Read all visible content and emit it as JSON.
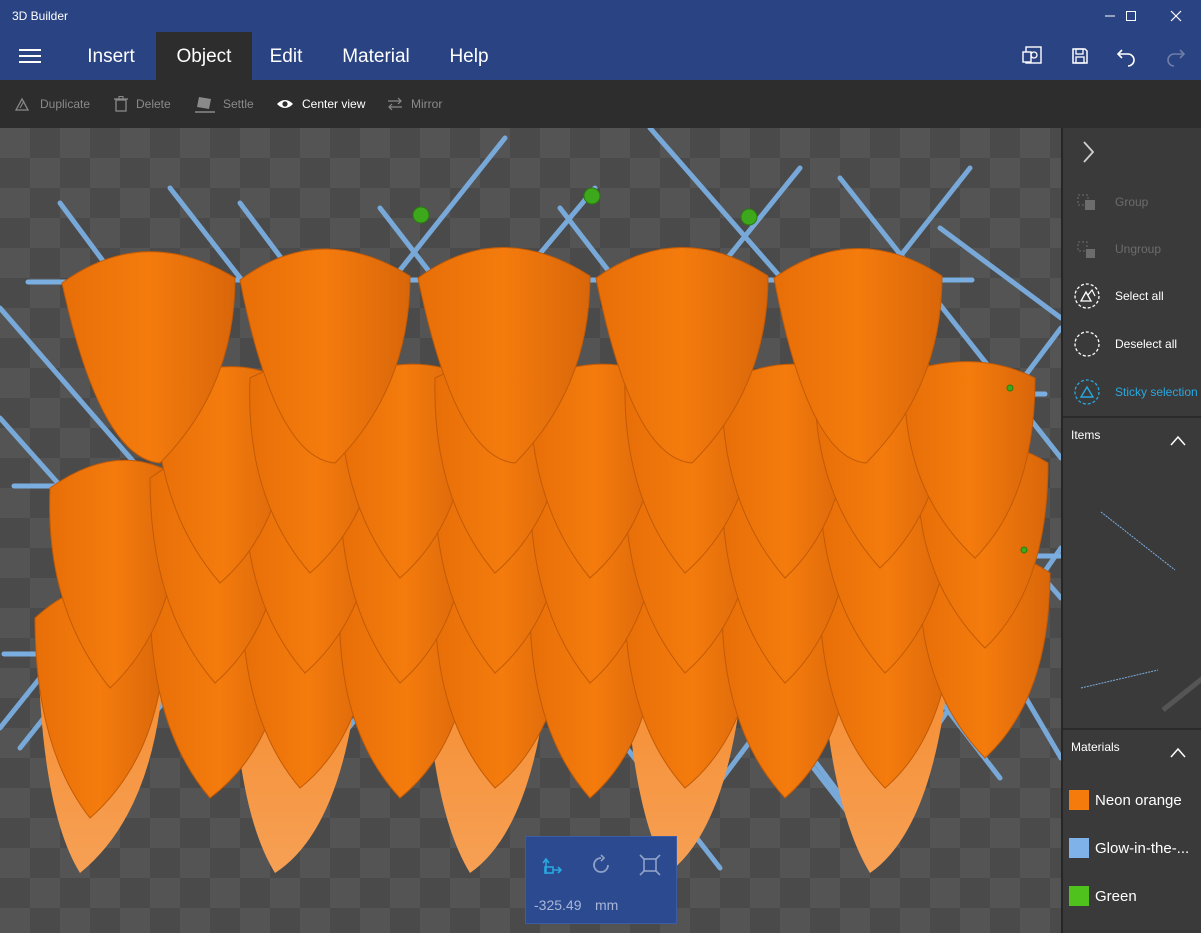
{
  "window": {
    "title": "3D Builder"
  },
  "menu": {
    "tabs": [
      {
        "label": "Insert"
      },
      {
        "label": "Object"
      },
      {
        "label": "Edit"
      },
      {
        "label": "Material"
      },
      {
        "label": "Help"
      }
    ],
    "active_tab": "Object"
  },
  "toolbar": {
    "duplicate": "Duplicate",
    "delete": "Delete",
    "settle": "Settle",
    "center_view": "Center view",
    "mirror": "Mirror"
  },
  "widget": {
    "value": "-325.49",
    "unit": "mm"
  },
  "panel": {
    "group": "Group",
    "ungroup": "Ungroup",
    "select_all": "Select all",
    "deselect_all": "Deselect all",
    "sticky_selection": "Sticky selection",
    "items_title": "Items",
    "materials_title": "Materials",
    "materials": [
      {
        "name": "Neon orange",
        "color": "#f47b0c"
      },
      {
        "name": "Glow-in-the-...",
        "color": "#7fb2e8"
      },
      {
        "name": "Green",
        "color": "#4fc21e"
      }
    ]
  },
  "colors": {
    "titlebar": "#2a4383",
    "toolbar": "#2d2d2d",
    "accent": "#29a8e0",
    "object_orange": "#f47b0c",
    "rod_blue": "#7aaee0",
    "joint_green": "#3ea81c"
  }
}
